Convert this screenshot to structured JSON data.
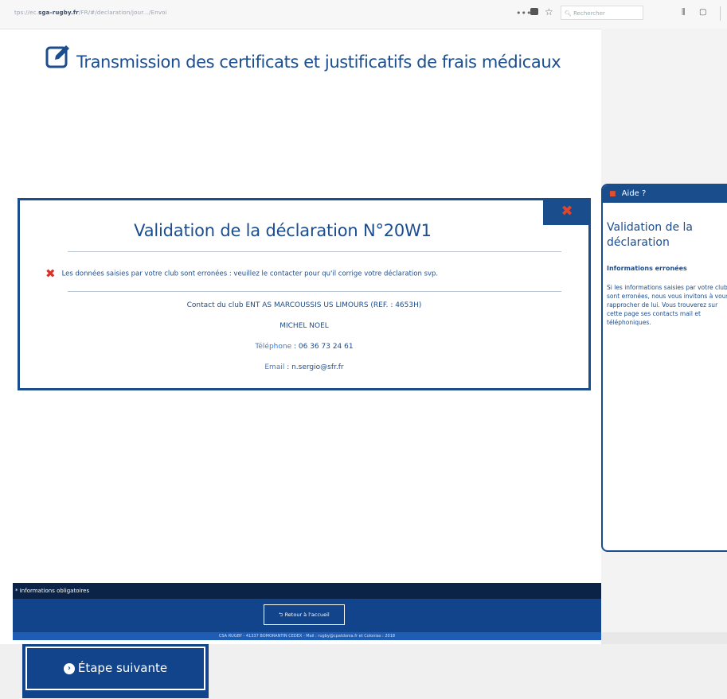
{
  "browser": {
    "url_prefix": "tps://ec.",
    "url_domain": "sga-rugby.fr",
    "url_path": "/FR/#/declaration/jour.../Envoi",
    "search_placeholder": "Rechercher",
    "menu_dots": "•••"
  },
  "page": {
    "title": "Transmission des certificats et justificatifs de frais médicaux"
  },
  "modal": {
    "title": "Validation de la déclaration N°20W1",
    "close_symbol": "✖",
    "error_text": "Les données saisies par votre club sont erronées : veuillez le contacter pour qu'il corrige votre déclaration svp.",
    "contact_line": "Contact du club ENT AS MARCOUSSIS US LIMOURS (REF. : 4653H)",
    "contact_name": "MICHEL NOEL",
    "phone_label": "Téléphone",
    "phone_value": " : 06 36 73 24 61",
    "email_label": "Email",
    "email_value": " : n.sergio@sfr.fr"
  },
  "help": {
    "header": "Aide ?",
    "title": "Validation de la déclaration",
    "subtitle": "Informations erronées",
    "text": "Si les informations saisies par votre club sont erronées, nous vous invitons à vous rapprocher de lui. Vous trouverez sur cette page ses contacts mail et téléphoniques."
  },
  "footer": {
    "required_note": "* Informations obligatoires",
    "home_button": "Retour à l'accueil",
    "legal": "CSA RUGBY - 41337 BOMORANTIN CEDEX - Mail : rugby@cpatdonia.fr et Colonias : 2018"
  },
  "next_button": {
    "label": "Étape suivante"
  }
}
